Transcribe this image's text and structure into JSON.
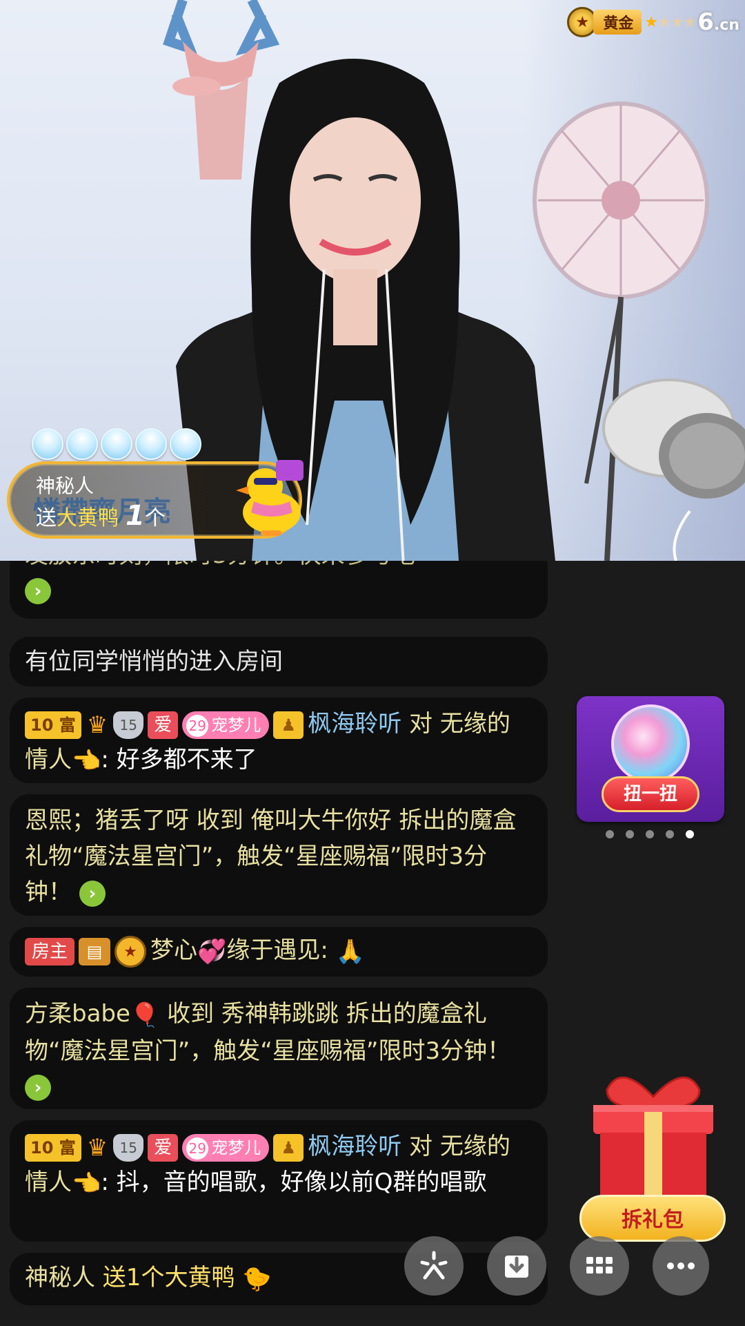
{
  "rank_badge": {
    "label": "黄金",
    "stars_on": 1,
    "stars_total": 4,
    "site": "6",
    "site_suffix": ".cn"
  },
  "gift_banner": {
    "sender": "神秘人",
    "overlay_text": "憐帶齊月亮",
    "send_prefix": "送",
    "gift_name": "大黄鸭",
    "count": "1",
    "unit": "个",
    "combo_count": 5
  },
  "chat": {
    "messages": [
      {
        "partial_text": "发放东时刻，限时3分钟。快来参与吧"
      },
      {
        "text": "有位同学悄悄的进入房间"
      },
      {
        "tags": {
          "rich": "10 富",
          "shield_level": "15",
          "love": "爱",
          "pet_level": "29",
          "pet_name": "宠梦儿",
          "vip": "♟"
        },
        "user": "枫海聆听",
        "verb": " 对 ",
        "target": "无缘的情人",
        "text": ": 好多都不来了"
      },
      {
        "text": "恩熙；猪丢了呀 收到 俺叫大牛你好 拆出的魔盒礼物“魔法星宫门”，触发“星座赐福”限时3分钟！"
      },
      {
        "tags": {
          "host": "房主"
        },
        "user": "梦心",
        "user2": "缘于遇见:"
      },
      {
        "user": "方柔babe",
        "text": " 收到 秀神韩跳跳 拆出的魔盒礼物“魔法星宫门”，触发“星座赐福”限时3分钟！"
      },
      {
        "tags": {
          "rich": "10 富",
          "shield_level": "15",
          "love": "爱",
          "pet_level": "29",
          "pet_name": "宠梦儿",
          "vip": "♟"
        },
        "user": "枫海聆听",
        "verb": " 对 ",
        "target": "无缘的情人",
        "text": ": 抖，音的唱歌，好像以前Q群的唱歌"
      },
      {
        "user": "神秘人",
        "text": " 送1个大黄鸭"
      }
    ]
  },
  "widgets": {
    "spin_label": "扭一扭",
    "page_dots": 5,
    "active_dot": 5,
    "red_packet_label": "拆礼包"
  },
  "toolbar": {
    "icons": [
      "sparkle-icon",
      "download-icon",
      "grid-icon",
      "more-icon"
    ]
  }
}
